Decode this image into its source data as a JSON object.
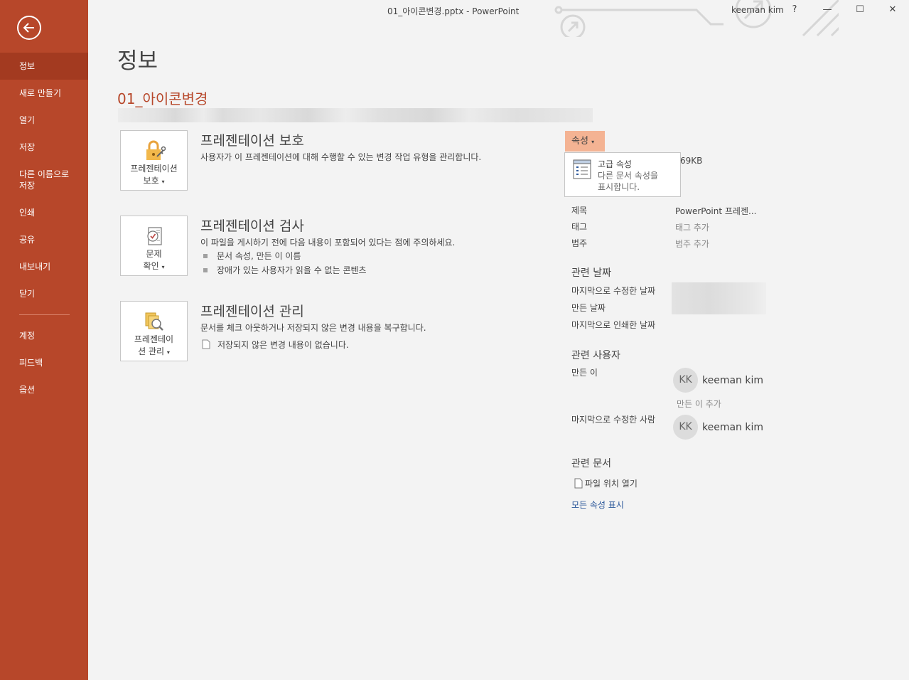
{
  "window": {
    "title": "01_아이콘변경.pptx  -  PowerPoint",
    "user": "keeman kim",
    "help_label": "?",
    "minimize_label": "—",
    "maximize_label": "☐",
    "close_label": "✕"
  },
  "sidebar": {
    "items": [
      {
        "label": "정보",
        "active": true
      },
      {
        "label": "새로 만들기"
      },
      {
        "label": "열기"
      },
      {
        "label": "저장"
      },
      {
        "label": "다른 이름으로 저장"
      },
      {
        "label": "인쇄"
      },
      {
        "label": "공유"
      },
      {
        "label": "내보내기"
      },
      {
        "label": "닫기"
      },
      {
        "label": "계정"
      },
      {
        "label": "피드백"
      },
      {
        "label": "옵션"
      }
    ],
    "save_as_line1": "다른 이름으로",
    "save_as_line2": "저장",
    "brand_color": "#b7472a"
  },
  "main": {
    "page_title": "정보",
    "file_name": "01_아이콘변경",
    "sections": [
      {
        "button_line1": "프레젠테이션",
        "button_line2": "보호",
        "icon": "lock-icon",
        "heading": "프레젠테이션 보호",
        "description": "사용자가 이 프레젠테이션에 대해 수행할 수 있는 변경 작업 유형을 관리합니다."
      },
      {
        "button_line1": "문제",
        "button_line2": "확인",
        "icon": "inspect-document-icon",
        "heading": "프레젠테이션 검사",
        "description": "이 파일을 게시하기 전에 다음 내용이 포함되어 있다는 점에 주의하세요.",
        "bullets": [
          "문서 속성, 만든 이 이름",
          "장애가 있는 사용자가 읽을 수 없는 콘텐츠"
        ]
      },
      {
        "button_line1": "프레젠테이",
        "button_line2": "션 관리",
        "icon": "manage-versions-icon",
        "heading": "프레젠테이션 관리",
        "description": "문서를 체크 아웃하거나 저장되지 않은 변경 내용을 복구합니다.",
        "note": "저장되지 않은 변경 내용이 없습니다."
      }
    ]
  },
  "properties": {
    "button_label": "속성",
    "menu": {
      "title": "고급 속성",
      "desc_line1": "다른 문서 속성을",
      "desc_line2": "표시합니다."
    },
    "size_value": "69KB",
    "rows": [
      {
        "label": "제목",
        "value": "PowerPoint 프레젠..."
      },
      {
        "label": "태그",
        "value": "태그 추가"
      },
      {
        "label": "범주",
        "value": "범주 추가"
      }
    ],
    "dates_heading": "관련 날짜",
    "dates": [
      "마지막으로 수정한 날짜",
      "만든 날짜",
      "마지막으로 인쇄한 날짜"
    ],
    "people_heading": "관련 사용자",
    "author_label": "만든 이",
    "author": {
      "initials": "KK",
      "name": "keeman kim"
    },
    "add_author": "만든 이 추가",
    "last_modified_by_label": "마지막으로 수정한 사람",
    "last_modified_by": {
      "initials": "KK",
      "name": "keeman kim"
    },
    "docs_heading": "관련 문서",
    "open_location": "파일 위치 열기",
    "show_all": "모든 속성 표시"
  }
}
